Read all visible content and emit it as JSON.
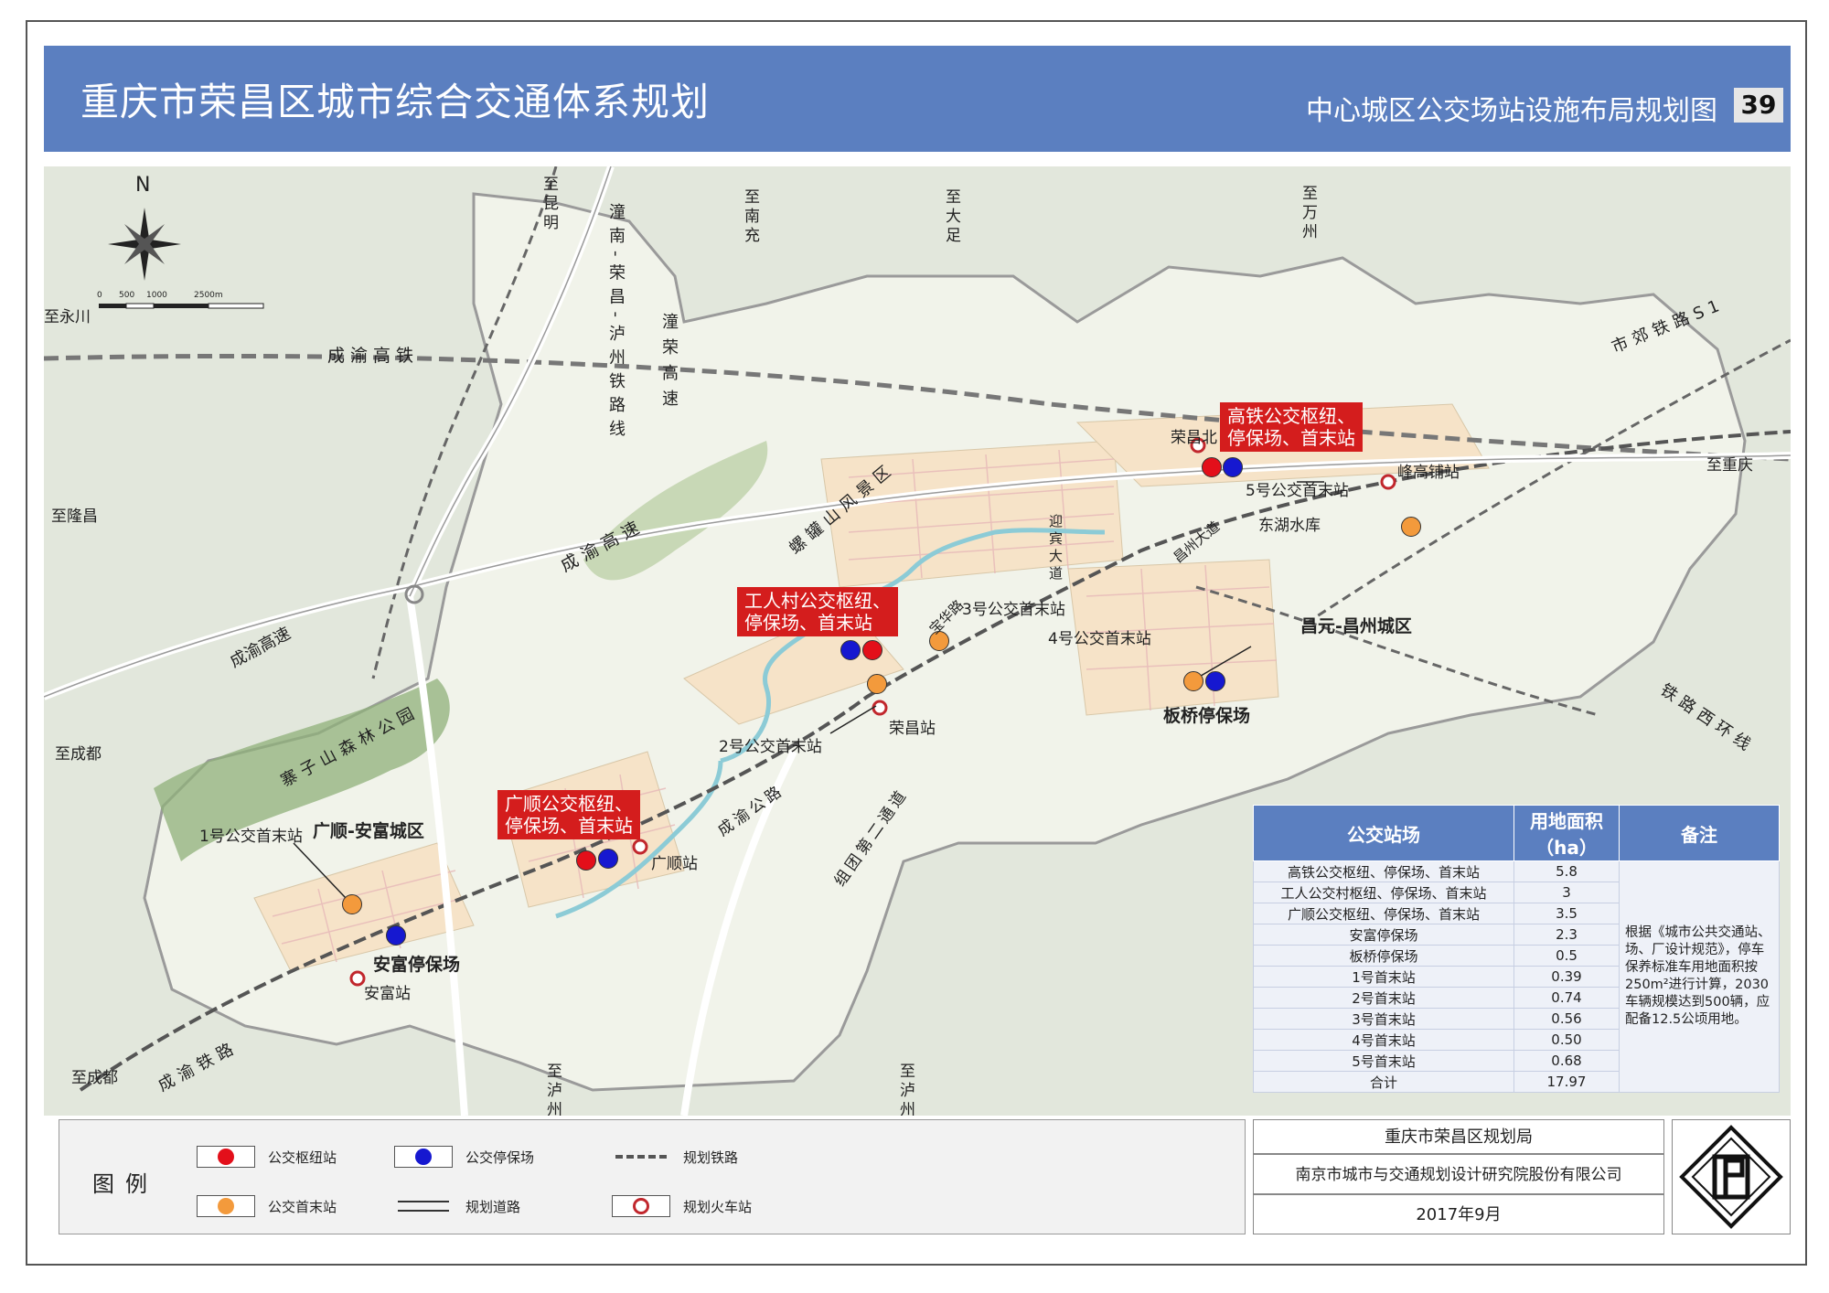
{
  "header": {
    "title": "重庆市荣昌区城市综合交通体系规划",
    "subtitle": "中心城区公交场站设施布局规划图",
    "page": "39"
  },
  "colors": {
    "header_blue": "#5b7fc0",
    "hub_red": "#e30f1a",
    "depot_blue": "#1618d0",
    "terminal_orange": "#f39a3c",
    "label_red": "#d41d1d"
  },
  "map": {
    "north": "N",
    "scale_ticks": [
      "0",
      "500",
      "1000",
      "2500m"
    ],
    "directions": [
      "至永川",
      "至南充",
      "至大足",
      "至万州",
      "至昆明",
      "至隆昌",
      "至重庆",
      "至成都",
      "至成都",
      "至泸州",
      "至泸州"
    ],
    "roads": {
      "chengyu_hsr": "成渝高铁",
      "chengyu_expy": "成渝高速",
      "chengyu_expy2": "成渝高速",
      "tongnan_expy": "潼荣高速",
      "tongnan_rail": "潼南-荣昌-泸州铁路线",
      "shijiao_rail": "市郊铁路S1",
      "rail_west_loop": "铁路西环线",
      "chengyu_rail": "成渝铁路",
      "chengyu_road": "成渝公路",
      "zutuan_road": "组团第二通道",
      "yingbin": "迎宾大道",
      "changzhou": "昌州大道",
      "xinghe": "宝华路"
    },
    "areas": {
      "luoguan": "螺罐山风景区",
      "zhaizi": "寨子山森林公园",
      "guangshun_anfu": "广顺-安富城区",
      "changyuan": "昌元-昌州城区",
      "donghu": "东湖水库"
    },
    "stations": {
      "rongchang_north": "荣昌北",
      "fenggaopu": "峰高铺站",
      "rongchang": "荣昌站",
      "guangshun": "广顺站",
      "anfu": "安富站"
    },
    "red_labels": {
      "hsr_hub": "高铁公交枢纽、\n停保场、首末站",
      "gongren_hub": "工人村公交枢纽、\n停保场、首末站",
      "guangshun_hub": "广顺公交枢纽、\n停保场、首末站"
    },
    "terminal_labels": {
      "t1": "1号公交首末站",
      "t2": "2号公交首末站",
      "t3": "3号公交首末站",
      "t4": "4号公交首末站",
      "t5": "5号公交首末站"
    },
    "depot_labels": {
      "anfu": "安富停保场",
      "banqiao": "板桥停保场"
    }
  },
  "table": {
    "headers": [
      "公交站场",
      "用地面积（ha）",
      "备注"
    ],
    "rows": [
      [
        "高铁公交枢纽、停保场、首末站",
        "5.8"
      ],
      [
        "工人公交村枢纽、停保场、首末站",
        "3"
      ],
      [
        "广顺公交枢纽、停保场、首末站",
        "3.5"
      ],
      [
        "安富停保场",
        "2.3"
      ],
      [
        "板桥停保场",
        "0.5"
      ],
      [
        "1号首末站",
        "0.39"
      ],
      [
        "2号首末站",
        "0.74"
      ],
      [
        "3号首末站",
        "0.56"
      ],
      [
        "4号首末站",
        "0.50"
      ],
      [
        "5号首末站",
        "0.68"
      ],
      [
        "合计",
        "17.97"
      ]
    ],
    "note": "根据《城市公共交通站、场、厂设计规范》，停车保养标准车用地面积按250m²进行计算，2030车辆规模达到500辆，应配备12.5公顷用地。"
  },
  "legend": {
    "title": "图例",
    "items": {
      "hub": "公交枢纽站",
      "depot": "公交停保场",
      "rail": "规划铁路",
      "terminal": "公交首末站",
      "road": "规划道路",
      "train": "规划火车站"
    }
  },
  "credits": {
    "client": "重庆市荣昌区规划局",
    "designer": "南京市城市与交通规划设计研究院股份有限公司",
    "date": "2017年9月"
  }
}
